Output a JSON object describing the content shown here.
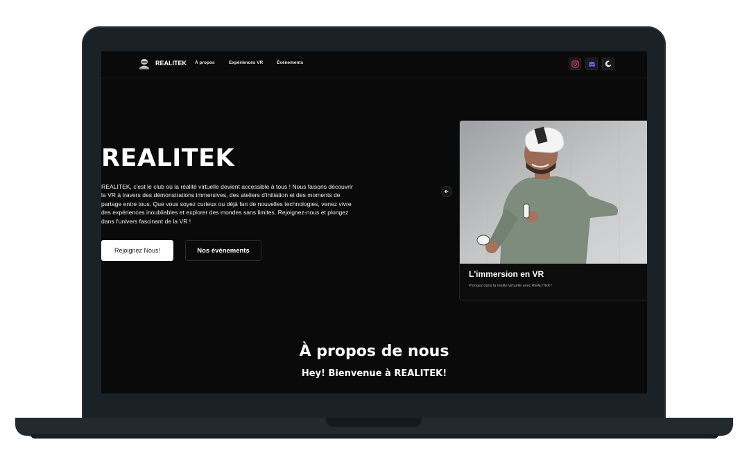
{
  "nav": {
    "brand": "REALITEK",
    "links": [
      "À propos",
      "Expériences VR",
      "Événements"
    ],
    "icons": [
      "instagram-icon",
      "discord-icon",
      "dark-mode-icon"
    ],
    "colors": {
      "instagram": "#e1306c",
      "discord": "#5865f2"
    }
  },
  "hero": {
    "title": "REALITEK",
    "description_lines": [
      "REALITEK, c'est le club où la réalité virtuelle devient accessible à tous ! Nous faisons découvrir",
      "la VR à travers des démonstrations immersives, des ateliers d'initiation et des moments de",
      "partage entre tous. Que vous soyez curieux ou déjà fan de nouvelles technologies, venez vivre",
      "des expériences inoubliables et explorer des mondes sans limites. Rejoignez-nous et plongez",
      "dans l'univers fascinant de la VR !"
    ],
    "primary_button": "Rejoignez Nous!",
    "secondary_button": "Nos événements"
  },
  "carousel": {
    "card_title": "L'immersion en VR",
    "card_text": "Plongez dans la réalité virtuelle avec REALITEK !"
  },
  "about": {
    "title": "À propos de nous",
    "subtitle": "Hey! Bienvenue à REALITEK!"
  }
}
